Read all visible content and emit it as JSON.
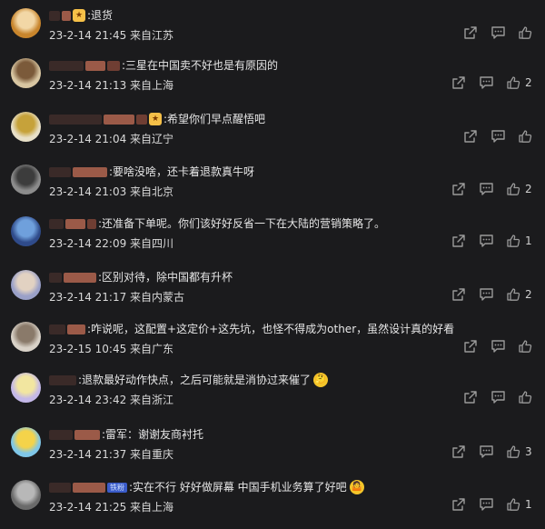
{
  "comments": [
    {
      "text": ":退货",
      "time": "23-2-14 21:45",
      "location": "来自江苏",
      "likes": "",
      "badge": true,
      "vip": false,
      "emoji": false,
      "avatar": "#c8852c",
      "avatar2": "#f2d7a6",
      "blur": [
        12,
        10
      ]
    },
    {
      "text": ":三星在中国卖不好也是有原因的",
      "time": "23-2-14 21:13",
      "location": "来自上海",
      "likes": "2",
      "badge": false,
      "vip": false,
      "emoji": false,
      "avatar": "#d8c6a2",
      "avatar2": "#7b5a3a",
      "blur": [
        38,
        22,
        14
      ]
    },
    {
      "text": ":希望你们早点醒悟吧",
      "time": "23-2-14 21:04",
      "location": "来自辽宁",
      "likes": "",
      "badge": true,
      "vip": false,
      "emoji": false,
      "avatar": "#e8e0c8",
      "avatar2": "#c6a23a",
      "blur": [
        58,
        34,
        12
      ]
    },
    {
      "text": ":要啥没啥，还卡着退款真牛呀",
      "time": "23-2-14 21:03",
      "location": "来自北京",
      "likes": "2",
      "badge": false,
      "vip": false,
      "emoji": false,
      "avatar": "#8c8c8c",
      "avatar2": "#3c3c3c",
      "blur": [
        24,
        38
      ]
    },
    {
      "text": ":还准备下单呢。你们该好好反省一下在大陆的营销策略了。",
      "time": "23-2-14 22:09",
      "location": "来自四川",
      "likes": "1",
      "badge": false,
      "vip": false,
      "emoji": false,
      "avatar": "#2f4b8a",
      "avatar2": "#6fa0dc",
      "blur": [
        16,
        22,
        10
      ]
    },
    {
      "text": ":区别对待，除中国都有升杯",
      "time": "23-2-14 21:17",
      "location": "来自内蒙古",
      "likes": "2",
      "badge": false,
      "vip": false,
      "emoji": false,
      "avatar": "#9aa0c8",
      "avatar2": "#e2d2c2",
      "blur": [
        14,
        36
      ]
    },
    {
      "text": ":咋说呢，这配置+这定价+这先坑，也怪不得成为other，虽然设计真的好看",
      "time": "23-2-15 10:45",
      "location": "来自广东",
      "likes": "",
      "badge": false,
      "vip": false,
      "emoji": false,
      "avatar": "#d9d2c8",
      "avatar2": "#8a7a6a",
      "blur": [
        18,
        20
      ]
    },
    {
      "text": ":退款最好动作快点，之后可能就是消协过来催了",
      "time": "23-2-14 23:42",
      "location": "来自浙江",
      "likes": "",
      "badge": false,
      "vip": false,
      "emoji": true,
      "emoji_char": "🤔",
      "avatar": "#c4b8e8",
      "avatar2": "#f2e6a0",
      "blur": [
        30
      ]
    },
    {
      "text": ":雷军：谢谢友商衬托",
      "time": "23-2-14 21:37",
      "location": "来自重庆",
      "likes": "3",
      "badge": false,
      "vip": false,
      "emoji": false,
      "avatar": "#7fc7e8",
      "avatar2": "#f4d34a",
      "blur": [
        26,
        28
      ]
    },
    {
      "text": ":实在不行 好好做屏幕 中国手机业务算了好吧",
      "time": "23-2-14 21:25",
      "location": "来自上海",
      "likes": "1",
      "badge": false,
      "vip": true,
      "vip_label": "铁粉",
      "emoji": true,
      "emoji_char": "🤷",
      "avatar": "#6a6a6a",
      "avatar2": "#b8b8b8",
      "blur": [
        24,
        36
      ]
    }
  ]
}
